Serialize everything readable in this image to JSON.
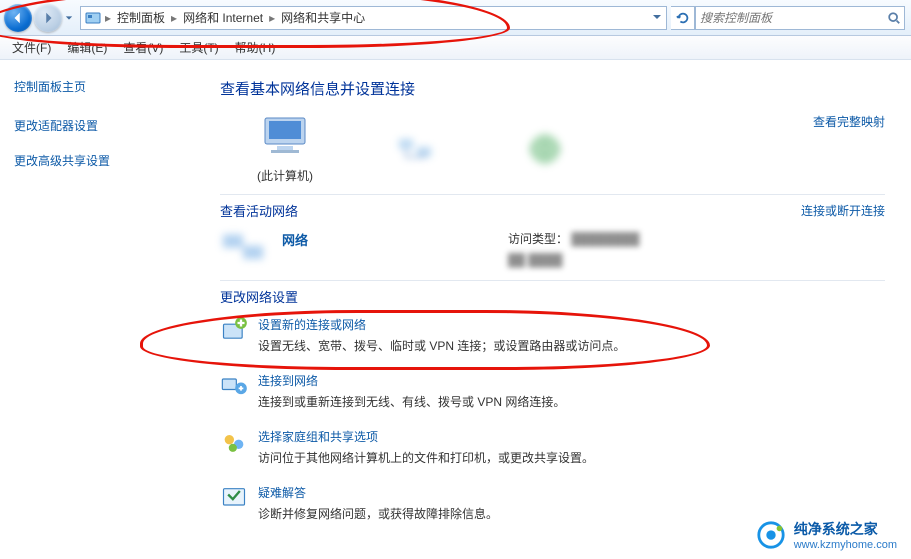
{
  "breadcrumb": {
    "items": [
      "控制面板",
      "网络和 Internet",
      "网络和共享中心"
    ]
  },
  "search": {
    "placeholder": "搜索控制面板"
  },
  "menu": {
    "file": "文件(F)",
    "edit": "编辑(E)",
    "view": "查看(V)",
    "tools": "工具(T)",
    "help": "帮助(H)"
  },
  "sidebar": {
    "home": "控制面板主页",
    "item1": "更改适配器设置",
    "item2": "更改高级共享设置"
  },
  "main": {
    "title": "查看基本网络信息并设置连接",
    "fullmap": "查看完整映射",
    "map": {
      "node1_caption": "(此计算机)",
      "node1_name": ""
    },
    "active": {
      "heading": "查看活动网络",
      "rlink": "连接或断开连接",
      "netname": "网络",
      "acctype_label": "访问类型："
    },
    "change_heading": "更改网络设置",
    "tasks": [
      {
        "title": "设置新的连接或网络",
        "desc": "设置无线、宽带、拨号、临时或 VPN 连接；或设置路由器或访问点。"
      },
      {
        "title": "连接到网络",
        "desc": "连接到或重新连接到无线、有线、拨号或 VPN 网络连接。"
      },
      {
        "title": "选择家庭组和共享选项",
        "desc": "访问位于其他网络计算机上的文件和打印机，或更改共享设置。"
      },
      {
        "title": "疑难解答",
        "desc": "诊断并修复网络问题，或获得故障排除信息。"
      }
    ]
  },
  "watermark": {
    "t1": "纯净系统之家",
    "t2": "www.kzmyhome.com"
  }
}
